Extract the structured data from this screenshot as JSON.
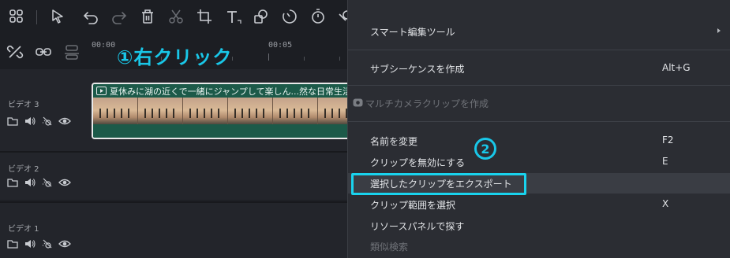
{
  "toolbar": {
    "icons": [
      "grid-icon",
      "select-arrow-icon",
      "undo-icon",
      "redo-icon",
      "delete-icon",
      "cut-icon",
      "crop-icon",
      "text-icon",
      "shape-icon",
      "speed-icon",
      "timer-icon",
      "more-icon"
    ]
  },
  "timeline": {
    "ruler_labels": [
      "00:00",
      "00:05"
    ],
    "annotation_1": "①右クリック",
    "tracks": [
      {
        "name": "ビデオ 3"
      },
      {
        "name": "ビデオ 2"
      },
      {
        "name": "ビデオ 1"
      }
    ],
    "clip": {
      "title": "夏休みに湖の近くで一緒にジャンプして楽しん...然な日常生活のコンセ"
    }
  },
  "context_menu": {
    "items": [
      {
        "label": "スマート編集ツール",
        "shortcut": "",
        "submenu": true
      },
      {
        "label": "サブシーケンスを作成",
        "shortcut": "Alt+G"
      },
      {
        "label": "マルチカメラクリップを作成",
        "shortcut": "",
        "disabled": true
      },
      {
        "label": "名前を変更",
        "shortcut": "F2"
      },
      {
        "label": "クリップを無効にする",
        "shortcut": "E"
      },
      {
        "label": "選択したクリップをエクスポート",
        "shortcut": "",
        "highlighted": true
      },
      {
        "label": "クリップ範囲を選択",
        "shortcut": "X"
      },
      {
        "label": "リソースパネルで探す",
        "shortcut": ""
      },
      {
        "label": "類似検索",
        "shortcut": "",
        "disabled": true
      }
    ],
    "annotation_2": "2"
  },
  "colors": {
    "accent_annotation": "#19c7e8",
    "clip_green": "#1c5a49",
    "menu_bg": "#2b2d33"
  }
}
